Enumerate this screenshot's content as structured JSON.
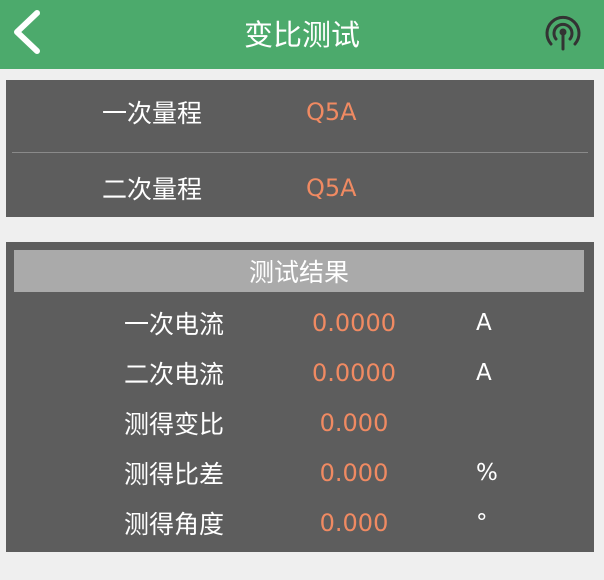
{
  "header": {
    "title": "变比测试",
    "back_icon": "chevron-left-icon",
    "signal_icon": "broadcast-signal-icon",
    "bg_color": "#4caa6c"
  },
  "range": {
    "rows": [
      {
        "label": "一次量程",
        "value": "Q5A"
      },
      {
        "label": "二次量程",
        "value": "Q5A"
      }
    ]
  },
  "results": {
    "title": "测试结果",
    "rows": [
      {
        "label": "一次电流",
        "value": "0.0000",
        "unit": "A"
      },
      {
        "label": "二次电流",
        "value": "0.0000",
        "unit": "A"
      },
      {
        "label": "测得变比",
        "value": "0.000",
        "unit": ""
      },
      {
        "label": "测得比差",
        "value": "0.000",
        "unit": "%"
      },
      {
        "label": "测得角度",
        "value": "0.000",
        "unit": "°"
      }
    ]
  },
  "colors": {
    "value": "#f08a62",
    "panel": "#5d5d5d",
    "result_header": "#aaaaaa"
  }
}
